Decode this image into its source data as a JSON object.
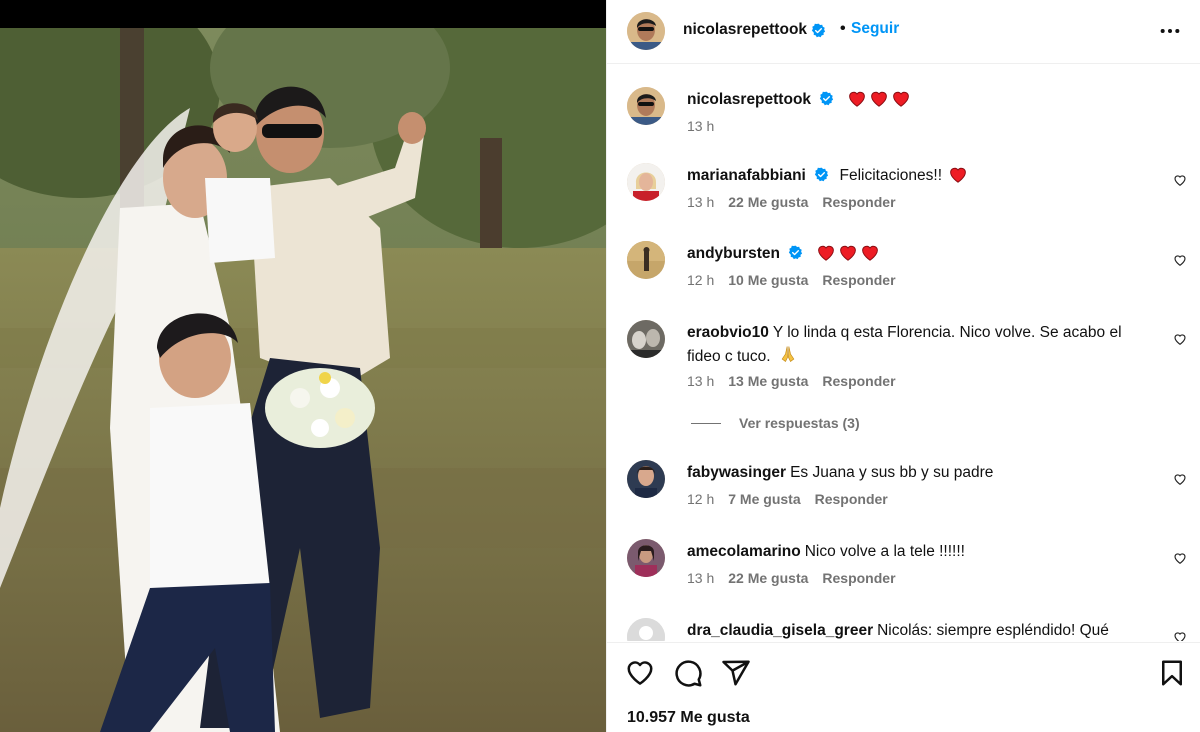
{
  "post": {
    "author": "nicolasrepettook",
    "follow_label": "Seguir",
    "separator": "•",
    "caption_time": "13 h",
    "likes_total": "10.957 Me gusta"
  },
  "comments": [
    {
      "user": "marianafabbiani",
      "verified": true,
      "text": "Felicitaciones!!",
      "hearts": 1,
      "time": "13 h",
      "likes": "22 Me gusta",
      "reply": "Responder"
    },
    {
      "user": "andybursten",
      "verified": true,
      "text": "",
      "hearts": 3,
      "time": "12 h",
      "likes": "10 Me gusta",
      "reply": "Responder"
    },
    {
      "user": "eraobvio10",
      "verified": false,
      "text": "Y lo linda q esta Florencia. Nico volve. Se acabo el fideo c tuco.",
      "pray": true,
      "time": "13 h",
      "likes": "13 Me gusta",
      "reply": "Responder"
    },
    {
      "user": "fabywasinger",
      "verified": false,
      "text": "Es Juana y sus bb y su padre",
      "time": "12 h",
      "likes": "7 Me gusta",
      "reply": "Responder"
    },
    {
      "user": "amecolamarino",
      "verified": false,
      "text": "Nico volve a la tele !!!!!!",
      "time": "13 h",
      "likes": "22 Me gusta",
      "reply": "Responder"
    },
    {
      "user": "dra_claudia_gisela_greer",
      "verified": false,
      "text": "Nicolás: siempre espléndido! Qué"
    }
  ],
  "view_replies_label": "Ver respuestas (3)",
  "icons": {
    "verified": "verified-badge-icon",
    "more": "more-options-icon",
    "like": "heart-icon",
    "comment": "comment-icon",
    "share": "send-icon",
    "save": "bookmark-icon"
  },
  "colors": {
    "accent": "#0095f6",
    "verified": "#0095f6",
    "heart_red": "#ed1c24",
    "muted": "#737373"
  }
}
